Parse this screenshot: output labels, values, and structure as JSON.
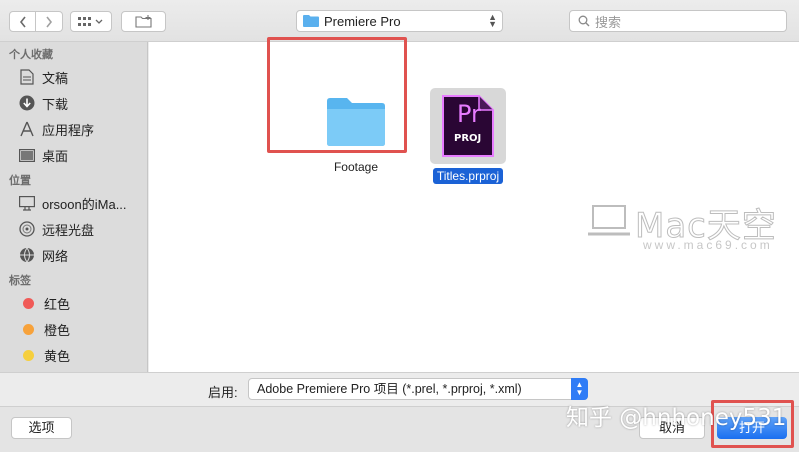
{
  "toolbar": {
    "location": "Premiere Pro",
    "search_placeholder": "搜索"
  },
  "sidebar": {
    "favorites_title": "个人收藏",
    "favorites": [
      {
        "label": "文稿",
        "icon": "document-icon"
      },
      {
        "label": "下载",
        "icon": "download-icon"
      },
      {
        "label": "应用程序",
        "icon": "applications-icon"
      },
      {
        "label": "桌面",
        "icon": "desktop-icon"
      }
    ],
    "locations_title": "位置",
    "locations": [
      {
        "label": "orsoon的iMa...",
        "icon": "computer-icon"
      },
      {
        "label": "远程光盘",
        "icon": "disc-icon"
      },
      {
        "label": "网络",
        "icon": "network-icon"
      }
    ],
    "tags_title": "标签",
    "tags": [
      {
        "label": "红色",
        "color": "#f05a57"
      },
      {
        "label": "橙色",
        "color": "#f7a23b"
      },
      {
        "label": "黄色",
        "color": "#f6cf3d"
      }
    ]
  },
  "files": [
    {
      "name": "Footage",
      "type": "folder"
    },
    {
      "name": "Titles.prproj",
      "type": "premiere-project",
      "selected": true,
      "icon_text_big": "Pr",
      "icon_text_small": "PROJ"
    }
  ],
  "watermark": {
    "brand": "Mac天空",
    "url": "www.mac69.com"
  },
  "filter": {
    "label": "启用:",
    "value": "Adobe Premiere Pro 项目 (*.prel, *.prproj, *.xml)"
  },
  "buttons": {
    "options": "选项",
    "cancel": "取消",
    "open": "打开"
  },
  "overlay_watermark": "知乎 @hnhoney531",
  "colors": {
    "accent": "#1a6ff0",
    "highlight_box": "#e0524f",
    "premiere_purple": "#e77cff"
  }
}
